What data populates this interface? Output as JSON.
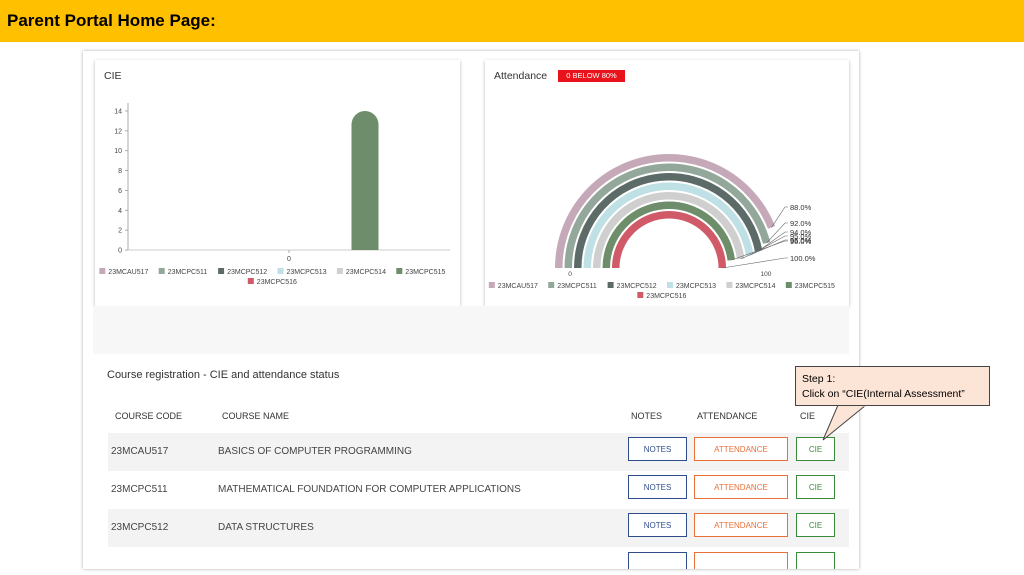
{
  "header": {
    "title": "Parent Portal Home Page:"
  },
  "cie_card": {
    "title": "CIE"
  },
  "attendance_card": {
    "title": "Attendance",
    "badge": "0 BELOW 80%"
  },
  "legend_courses": [
    "23MCAU517",
    "23MCPC511",
    "23MCPC512",
    "23MCPC513",
    "23MCPC514",
    "23MCPC515",
    "23MCPC516"
  ],
  "series_colors": [
    "#c5a9b8",
    "#93a89a",
    "#5d6b68",
    "#bfe0e4",
    "#cfcfcf",
    "#6e8d6a",
    "#d05a68"
  ],
  "chart_data": [
    {
      "type": "bar",
      "title": "CIE",
      "categories": [
        "0"
      ],
      "series": [
        {
          "name": "23MCAU517",
          "values": [
            0
          ]
        },
        {
          "name": "23MCPC511",
          "values": [
            0
          ]
        },
        {
          "name": "23MCPC512",
          "values": [
            0
          ]
        },
        {
          "name": "23MCPC513",
          "values": [
            0
          ]
        },
        {
          "name": "23MCPC514",
          "values": [
            0
          ]
        },
        {
          "name": "23MCPC515",
          "values": [
            14
          ]
        },
        {
          "name": "23MCPC516",
          "values": [
            0
          ]
        }
      ],
      "yticks": [
        "0",
        "2",
        "4",
        "6",
        "8",
        "10",
        "12",
        "14"
      ],
      "ylim": [
        0,
        14
      ],
      "legend_position": "bottom"
    },
    {
      "type": "radial-bar",
      "title": "Attendance",
      "series": [
        {
          "name": "23MCAU517",
          "value": 88.0
        },
        {
          "name": "23MCPC511",
          "value": 92.0
        },
        {
          "name": "23MCPC512",
          "value": 94.0
        },
        {
          "name": "23MCPC513",
          "value": 95.0
        },
        {
          "name": "23MCPC514",
          "value": 96.0
        },
        {
          "name": "23MCPC515",
          "value": 96.0
        },
        {
          "name": "23MCPC516",
          "value": 100.0
        }
      ],
      "labels": [
        "88.0%",
        "92.0%",
        "94.0%",
        "95.0%",
        "96.0%",
        "96.0%",
        "100.0%"
      ],
      "axis_labels": [
        "0",
        "100"
      ],
      "range": [
        0,
        100
      ],
      "legend_position": "bottom"
    }
  ],
  "registration": {
    "title": "Course registration - CIE and attendance status",
    "headers": {
      "code": "COURSE CODE",
      "name": "COURSE NAME",
      "notes": "NOTES",
      "attendance": "ATTENDANCE",
      "cie": "CIE"
    },
    "rows": [
      {
        "code": "23MCAU517",
        "name": "BASICS OF COMPUTER PROGRAMMING",
        "notes": "NOTES",
        "attendance": "ATTENDANCE",
        "cie": "CIE"
      },
      {
        "code": "23MCPC511",
        "name": "MATHEMATICAL FOUNDATION FOR COMPUTER APPLICATIONS",
        "notes": "NOTES",
        "attendance": "ATTENDANCE",
        "cie": "CIE"
      },
      {
        "code": "23MCPC512",
        "name": "DATA STRUCTURES",
        "notes": "NOTES",
        "attendance": "ATTENDANCE",
        "cie": "CIE"
      }
    ]
  },
  "callout": {
    "line1": "Step 1:",
    "line2": "Click on “CIE(Internal Assessment”"
  }
}
